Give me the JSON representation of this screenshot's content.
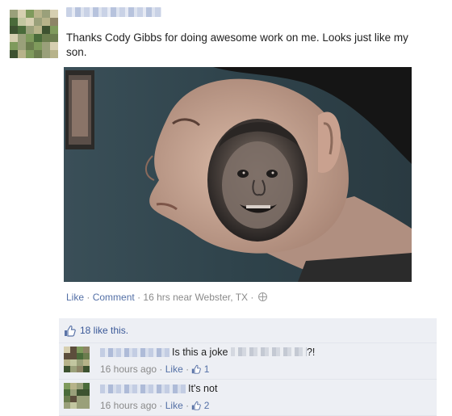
{
  "post": {
    "text": "Thanks Cody Gibbs for doing awesome work on me. Looks just like my son.",
    "actions": {
      "like_label": "Like",
      "comment_label": "Comment",
      "sep": "·",
      "meta": "16 hrs near Webster, TX"
    },
    "icons": {
      "privacy": "globe-icon",
      "like": "thumbs-up-icon"
    }
  },
  "likes": {
    "text": "18 like this."
  },
  "comments": [
    {
      "text_prefix": "Is this a joke",
      "text_suffix": "?!",
      "time": "16 hours ago",
      "like_label": "Like",
      "like_count": "1"
    },
    {
      "text_prefix": "It's not",
      "text_suffix": "",
      "time": "16 hours ago",
      "like_label": "Like",
      "like_count": "2"
    }
  ],
  "colors": {
    "link": "#5470a6",
    "likes_bg": "#edeff4",
    "name_link": "#3b5998"
  }
}
